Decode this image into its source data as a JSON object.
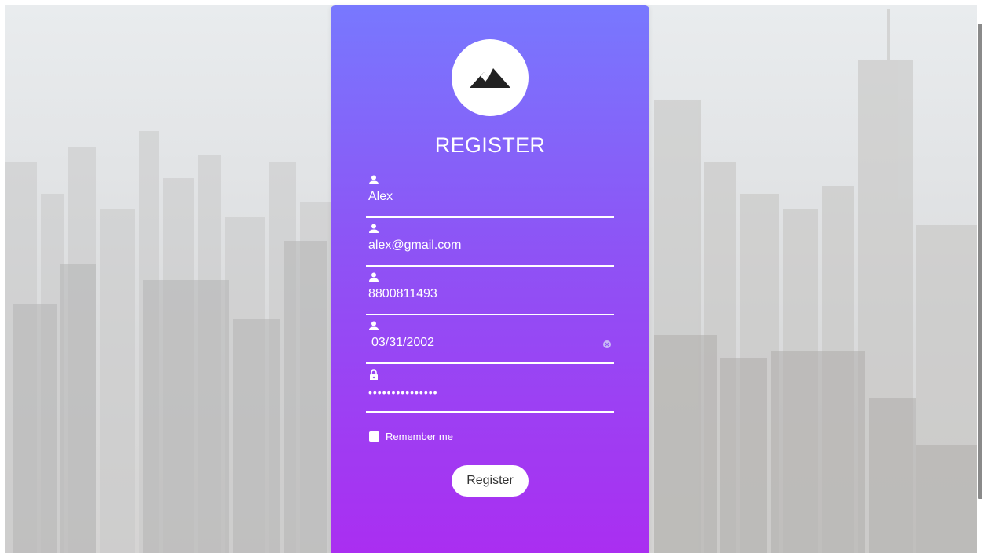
{
  "form": {
    "title": "REGISTER",
    "fields": [
      {
        "icon": "user-icon",
        "value": "Alex"
      },
      {
        "icon": "user-icon",
        "value": "alex@gmail.com"
      },
      {
        "icon": "user-icon",
        "value": "8800811493"
      },
      {
        "icon": "user-icon",
        "value": "03/31/2002"
      },
      {
        "icon": "lock-icon",
        "value": "•••••••••••••••"
      }
    ],
    "remember_label": "Remember me",
    "register_label": "Register"
  },
  "colors": {
    "gradient_top": "#7878fe",
    "gradient_bottom": "#aa2ef1",
    "text": "#ffffff",
    "button_text": "#333333"
  },
  "icons": [
    "mountain-logo-icon",
    "user-icon",
    "lock-icon",
    "clear-icon"
  ]
}
